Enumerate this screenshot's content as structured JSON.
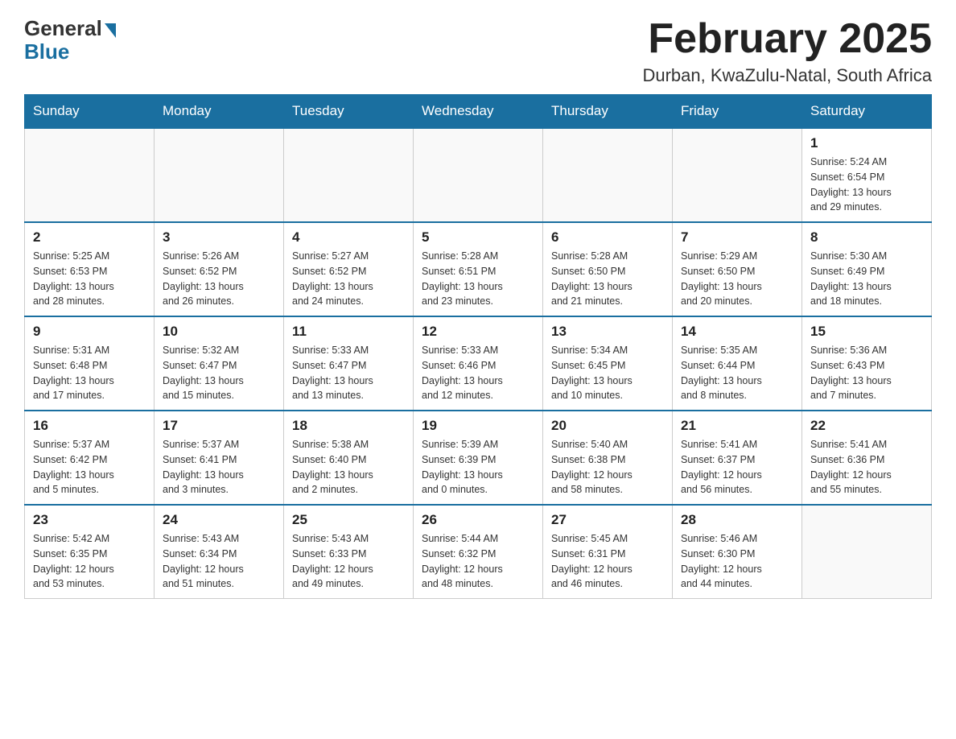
{
  "header": {
    "logo_general": "General",
    "logo_blue": "Blue",
    "main_title": "February 2025",
    "subtitle": "Durban, KwaZulu-Natal, South Africa"
  },
  "days_of_week": [
    "Sunday",
    "Monday",
    "Tuesday",
    "Wednesday",
    "Thursday",
    "Friday",
    "Saturday"
  ],
  "weeks": [
    {
      "days": [
        {
          "date": "",
          "info": ""
        },
        {
          "date": "",
          "info": ""
        },
        {
          "date": "",
          "info": ""
        },
        {
          "date": "",
          "info": ""
        },
        {
          "date": "",
          "info": ""
        },
        {
          "date": "",
          "info": ""
        },
        {
          "date": "1",
          "info": "Sunrise: 5:24 AM\nSunset: 6:54 PM\nDaylight: 13 hours\nand 29 minutes."
        }
      ]
    },
    {
      "days": [
        {
          "date": "2",
          "info": "Sunrise: 5:25 AM\nSunset: 6:53 PM\nDaylight: 13 hours\nand 28 minutes."
        },
        {
          "date": "3",
          "info": "Sunrise: 5:26 AM\nSunset: 6:52 PM\nDaylight: 13 hours\nand 26 minutes."
        },
        {
          "date": "4",
          "info": "Sunrise: 5:27 AM\nSunset: 6:52 PM\nDaylight: 13 hours\nand 24 minutes."
        },
        {
          "date": "5",
          "info": "Sunrise: 5:28 AM\nSunset: 6:51 PM\nDaylight: 13 hours\nand 23 minutes."
        },
        {
          "date": "6",
          "info": "Sunrise: 5:28 AM\nSunset: 6:50 PM\nDaylight: 13 hours\nand 21 minutes."
        },
        {
          "date": "7",
          "info": "Sunrise: 5:29 AM\nSunset: 6:50 PM\nDaylight: 13 hours\nand 20 minutes."
        },
        {
          "date": "8",
          "info": "Sunrise: 5:30 AM\nSunset: 6:49 PM\nDaylight: 13 hours\nand 18 minutes."
        }
      ]
    },
    {
      "days": [
        {
          "date": "9",
          "info": "Sunrise: 5:31 AM\nSunset: 6:48 PM\nDaylight: 13 hours\nand 17 minutes."
        },
        {
          "date": "10",
          "info": "Sunrise: 5:32 AM\nSunset: 6:47 PM\nDaylight: 13 hours\nand 15 minutes."
        },
        {
          "date": "11",
          "info": "Sunrise: 5:33 AM\nSunset: 6:47 PM\nDaylight: 13 hours\nand 13 minutes."
        },
        {
          "date": "12",
          "info": "Sunrise: 5:33 AM\nSunset: 6:46 PM\nDaylight: 13 hours\nand 12 minutes."
        },
        {
          "date": "13",
          "info": "Sunrise: 5:34 AM\nSunset: 6:45 PM\nDaylight: 13 hours\nand 10 minutes."
        },
        {
          "date": "14",
          "info": "Sunrise: 5:35 AM\nSunset: 6:44 PM\nDaylight: 13 hours\nand 8 minutes."
        },
        {
          "date": "15",
          "info": "Sunrise: 5:36 AM\nSunset: 6:43 PM\nDaylight: 13 hours\nand 7 minutes."
        }
      ]
    },
    {
      "days": [
        {
          "date": "16",
          "info": "Sunrise: 5:37 AM\nSunset: 6:42 PM\nDaylight: 13 hours\nand 5 minutes."
        },
        {
          "date": "17",
          "info": "Sunrise: 5:37 AM\nSunset: 6:41 PM\nDaylight: 13 hours\nand 3 minutes."
        },
        {
          "date": "18",
          "info": "Sunrise: 5:38 AM\nSunset: 6:40 PM\nDaylight: 13 hours\nand 2 minutes."
        },
        {
          "date": "19",
          "info": "Sunrise: 5:39 AM\nSunset: 6:39 PM\nDaylight: 13 hours\nand 0 minutes."
        },
        {
          "date": "20",
          "info": "Sunrise: 5:40 AM\nSunset: 6:38 PM\nDaylight: 12 hours\nand 58 minutes."
        },
        {
          "date": "21",
          "info": "Sunrise: 5:41 AM\nSunset: 6:37 PM\nDaylight: 12 hours\nand 56 minutes."
        },
        {
          "date": "22",
          "info": "Sunrise: 5:41 AM\nSunset: 6:36 PM\nDaylight: 12 hours\nand 55 minutes."
        }
      ]
    },
    {
      "days": [
        {
          "date": "23",
          "info": "Sunrise: 5:42 AM\nSunset: 6:35 PM\nDaylight: 12 hours\nand 53 minutes."
        },
        {
          "date": "24",
          "info": "Sunrise: 5:43 AM\nSunset: 6:34 PM\nDaylight: 12 hours\nand 51 minutes."
        },
        {
          "date": "25",
          "info": "Sunrise: 5:43 AM\nSunset: 6:33 PM\nDaylight: 12 hours\nand 49 minutes."
        },
        {
          "date": "26",
          "info": "Sunrise: 5:44 AM\nSunset: 6:32 PM\nDaylight: 12 hours\nand 48 minutes."
        },
        {
          "date": "27",
          "info": "Sunrise: 5:45 AM\nSunset: 6:31 PM\nDaylight: 12 hours\nand 46 minutes."
        },
        {
          "date": "28",
          "info": "Sunrise: 5:46 AM\nSunset: 6:30 PM\nDaylight: 12 hours\nand 44 minutes."
        },
        {
          "date": "",
          "info": ""
        }
      ]
    }
  ]
}
